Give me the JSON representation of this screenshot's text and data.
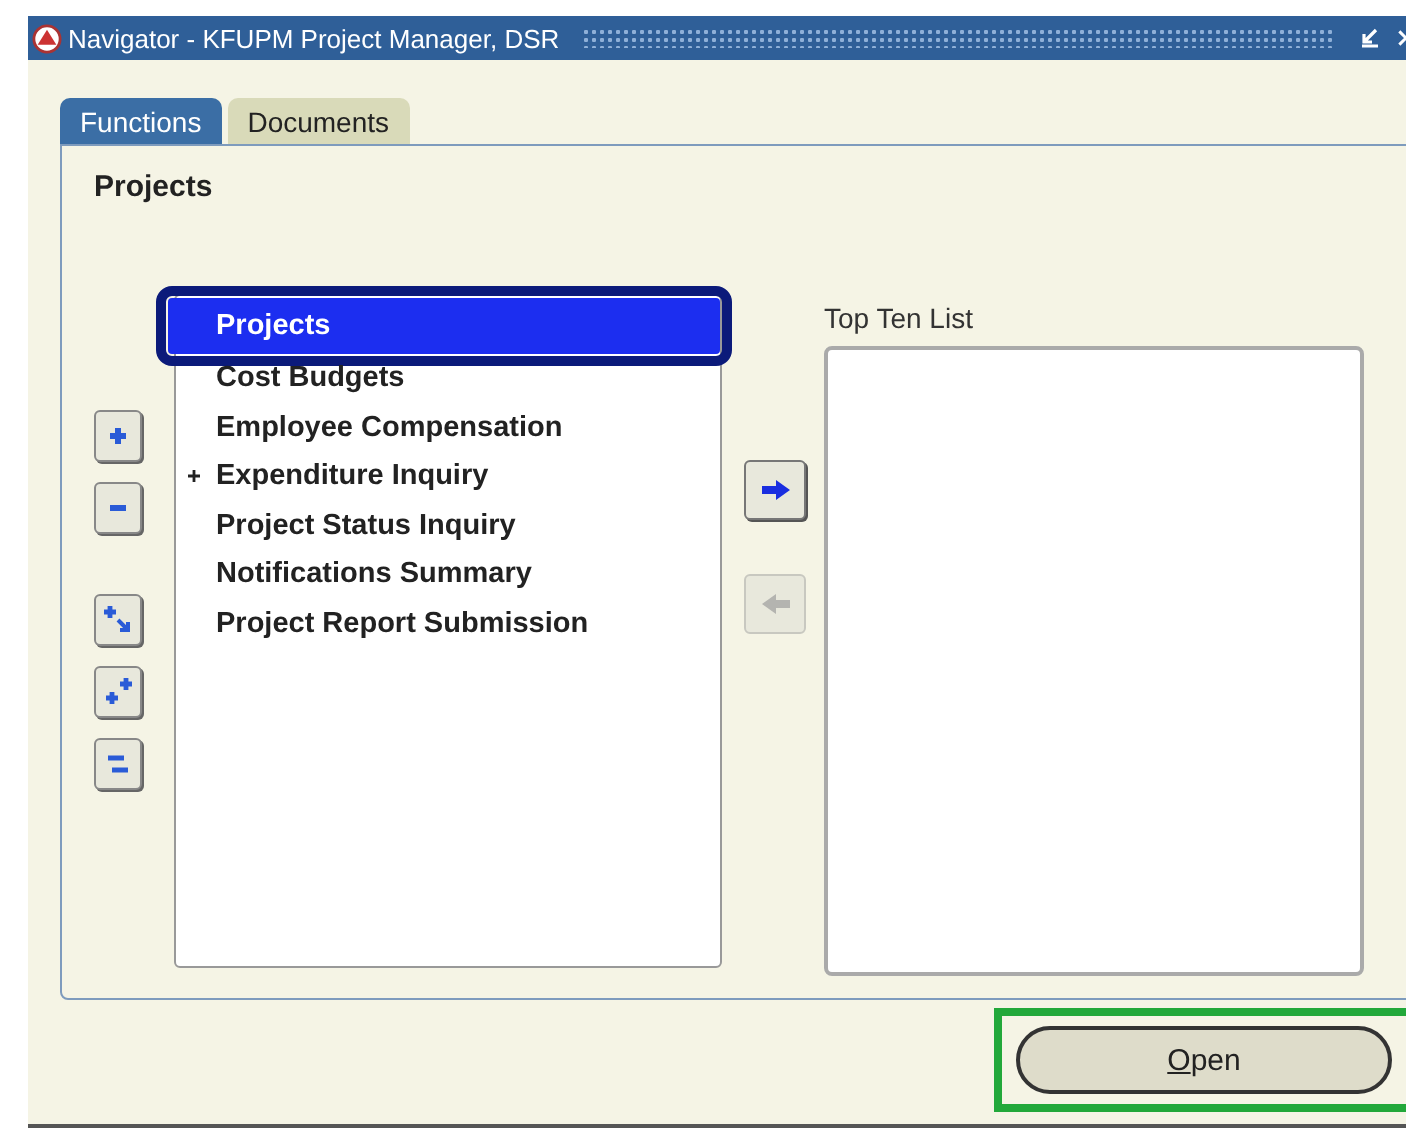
{
  "window": {
    "title": "Navigator - KFUPM Project Manager, DSR"
  },
  "tabs": [
    {
      "label": "Functions",
      "selected": true
    },
    {
      "label": "Documents",
      "selected": false
    }
  ],
  "panel_title": "Projects",
  "tree_tools": [
    {
      "kind": "expand"
    },
    {
      "kind": "collapse"
    },
    {
      "kind": "expand-branch"
    },
    {
      "kind": "expand-all"
    },
    {
      "kind": "collapse-all"
    }
  ],
  "functions": [
    {
      "label": "Projects",
      "selected": true,
      "expandable": false,
      "highlighted": true
    },
    {
      "label": "Cost Budgets",
      "selected": false,
      "expandable": false,
      "highlighted": false
    },
    {
      "label": "Employee Compensation",
      "selected": false,
      "expandable": false,
      "highlighted": false
    },
    {
      "label": "Expenditure Inquiry",
      "selected": false,
      "expandable": true,
      "highlighted": false
    },
    {
      "label": "Project Status Inquiry",
      "selected": false,
      "expandable": false,
      "highlighted": false
    },
    {
      "label": "Notifications Summary",
      "selected": false,
      "expandable": false,
      "highlighted": false
    },
    {
      "label": "Project Report Submission",
      "selected": false,
      "expandable": false,
      "highlighted": false
    }
  ],
  "move_buttons": [
    {
      "kind": "add",
      "disabled": false
    },
    {
      "kind": "remove",
      "disabled": true
    }
  ],
  "top_ten": {
    "label": "Top Ten List"
  },
  "open_button": {
    "label": "Open",
    "highlighted": true
  }
}
